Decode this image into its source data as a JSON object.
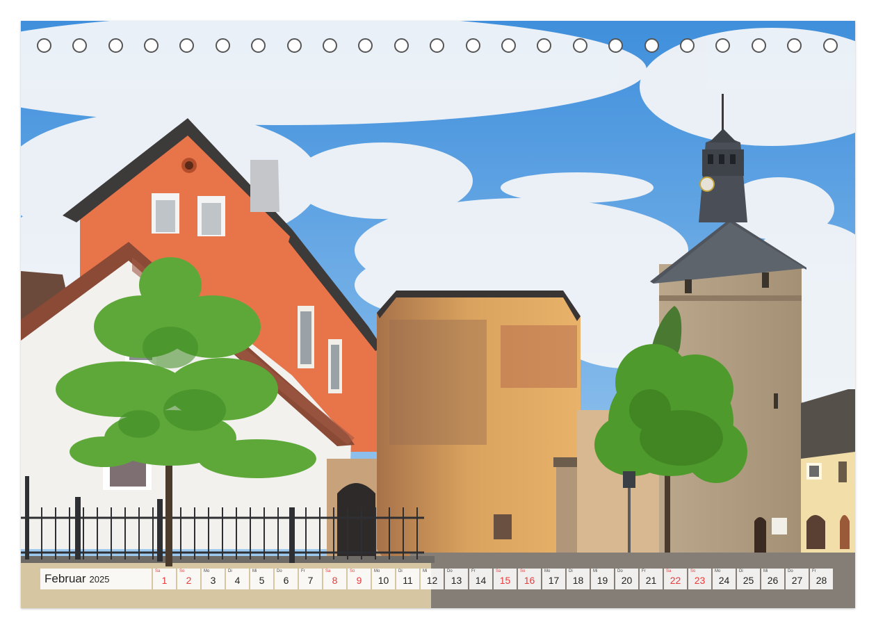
{
  "calendar": {
    "month": "Februar",
    "year": "2025",
    "days": [
      {
        "wd": "Sa",
        "num": "1",
        "weekend": true
      },
      {
        "wd": "So",
        "num": "2",
        "weekend": true
      },
      {
        "wd": "Mo",
        "num": "3",
        "weekend": false
      },
      {
        "wd": "Di",
        "num": "4",
        "weekend": false
      },
      {
        "wd": "Mi",
        "num": "5",
        "weekend": false
      },
      {
        "wd": "Do",
        "num": "6",
        "weekend": false
      },
      {
        "wd": "Fr",
        "num": "7",
        "weekend": false
      },
      {
        "wd": "Sa",
        "num": "8",
        "weekend": true
      },
      {
        "wd": "So",
        "num": "9",
        "weekend": true
      },
      {
        "wd": "Mo",
        "num": "10",
        "weekend": false
      },
      {
        "wd": "Di",
        "num": "11",
        "weekend": false
      },
      {
        "wd": "Mi",
        "num": "12",
        "weekend": false
      },
      {
        "wd": "Do",
        "num": "13",
        "weekend": false
      },
      {
        "wd": "Fr",
        "num": "14",
        "weekend": false
      },
      {
        "wd": "Sa",
        "num": "15",
        "weekend": true
      },
      {
        "wd": "So",
        "num": "16",
        "weekend": true
      },
      {
        "wd": "Mo",
        "num": "17",
        "weekend": false
      },
      {
        "wd": "Di",
        "num": "18",
        "weekend": false
      },
      {
        "wd": "Mi",
        "num": "19",
        "weekend": false
      },
      {
        "wd": "Do",
        "num": "20",
        "weekend": false
      },
      {
        "wd": "Fr",
        "num": "21",
        "weekend": false
      },
      {
        "wd": "Sa",
        "num": "22",
        "weekend": true
      },
      {
        "wd": "So",
        "num": "23",
        "weekend": true
      },
      {
        "wd": "Mo",
        "num": "24",
        "weekend": false
      },
      {
        "wd": "Di",
        "num": "25",
        "weekend": false
      },
      {
        "wd": "Mi",
        "num": "26",
        "weekend": false
      },
      {
        "wd": "Do",
        "num": "27",
        "weekend": false
      },
      {
        "wd": "Fr",
        "num": "28",
        "weekend": false
      }
    ]
  },
  "colors": {
    "weekend": "#e8393b",
    "sky": "#4d9be0",
    "plaster_orange": "#e8744a",
    "sandstone": "#c99a6a",
    "tree_green": "#4f9a2c"
  }
}
